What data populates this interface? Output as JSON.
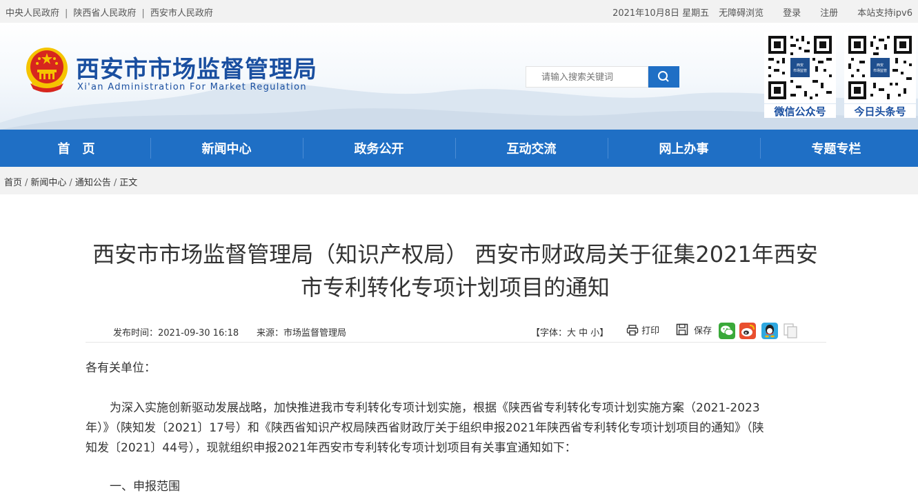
{
  "topbar": {
    "links": [
      "中央人民政府",
      "陕西省人民政府",
      "西安市人民政府"
    ],
    "sep": "|",
    "date": "2021年10月8日 星期五",
    "accessibility": "无障碍浏览",
    "login": "登录",
    "register": "注册",
    "ipv6": "本站支持ipv6"
  },
  "header": {
    "title": "西安市市场监督管理局",
    "subtitle": "Xi'an Administration For Market Regulation",
    "search_placeholder": "请输入搜索关键词",
    "qr_codes": [
      {
        "label": "微信公众号",
        "badge": "西安\n市场监管"
      },
      {
        "label": "今日头条号",
        "badge": "西安\n市场监管"
      }
    ]
  },
  "nav": {
    "items": [
      "首　页",
      "新闻中心",
      "政务公开",
      "互动交流",
      "网上办事",
      "专题专栏"
    ]
  },
  "breadcrumb": {
    "items": [
      "首页",
      "新闻中心",
      "通知公告",
      "正文"
    ],
    "sep": "/"
  },
  "article": {
    "title_line1": "西安市市场监督管理局（知识产权局） 西安市财政局关于征集2021年西安",
    "title_line2": "市专利转化专项计划项目的通知",
    "publish": "发布时间：2021-09-30 16:18",
    "source": "来源：市场监督管理局",
    "font_size": "【字体：大 中 小】",
    "print": "打印",
    "save": "保存",
    "greeting": "各有关单位：",
    "para1_line1": "为深入实施创新驱动发展战略，加快推进我市专利转化专项计划实施，根据《陕西省专利转化专项计划实施方案（2021-2023",
    "para1_line2": "年）》（陕知发〔2021〕17号）和《陕西省知识产权局陕西省财政厅关于组织申报2021年陕西省专利转化专项计划项目的通知》（陕",
    "para1_line3": "知发〔2021〕44号），现就组织申报2021年西安市专利转化专项计划项目有关事宜通知如下：",
    "section1": "一、申报范围"
  },
  "colors": {
    "brand_blue": "#1f6fc5",
    "title_blue": "#1a4fa0",
    "emblem_red": "#d7261e",
    "emblem_gold": "#f5c400"
  }
}
